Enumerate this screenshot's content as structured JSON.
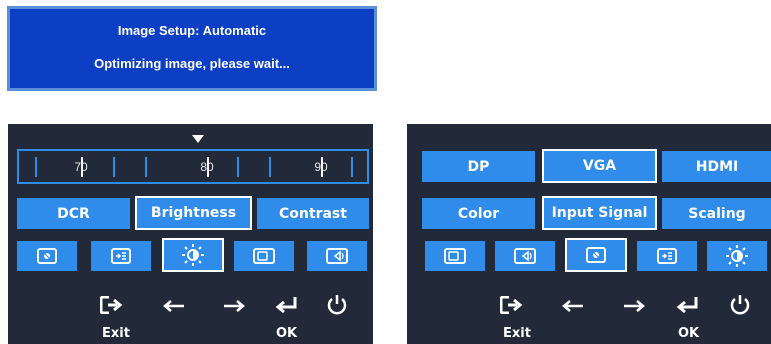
{
  "banner": {
    "title": "Image Setup: Automatic",
    "message": "Optimizing image, please wait..."
  },
  "left_panel": {
    "slider": {
      "labels": [
        "70",
        "80",
        "90"
      ],
      "value": 80
    },
    "buttons": [
      "DCR",
      "Brightness",
      "Contrast"
    ],
    "selected_button": "Brightness",
    "icon_buttons": [
      "picture-icon",
      "input-select-icon",
      "brightness-icon",
      "monitor-icon",
      "volume-monitor-icon"
    ],
    "selected_icon": "brightness-icon",
    "nav": {
      "exit_label": "Exit",
      "ok_label": "OK"
    }
  },
  "right_panel": {
    "row1": [
      "DP",
      "VGA",
      "HDMI"
    ],
    "row2": [
      "Color",
      "Input Signal",
      "Scaling"
    ],
    "selected_buttons": [
      "VGA",
      "Input Signal"
    ],
    "icon_buttons": [
      "monitor-icon",
      "volume-monitor-icon",
      "picture-icon",
      "input-select-icon",
      "brightness-icon"
    ],
    "selected_icon": "picture-icon",
    "nav": {
      "exit_label": "Exit",
      "ok_label": "OK"
    }
  },
  "colors": {
    "banner_bg": "#0c3fc4",
    "osd_bg": "#222938",
    "button_blue": "#2f8ceb",
    "selected_border": "#ffffff"
  }
}
